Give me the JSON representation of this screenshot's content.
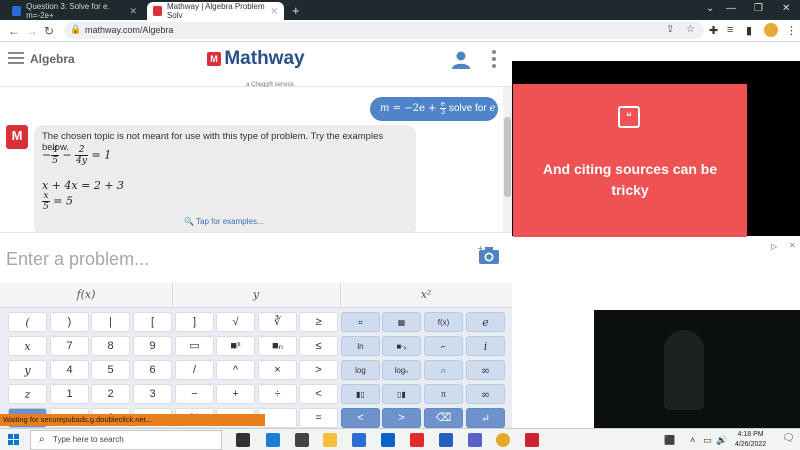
{
  "browser": {
    "tabs": [
      {
        "title": "Question 3: Solve for e. m=-2e+",
        "active": false
      },
      {
        "title": "Mathway | Algebra Problem Solv",
        "active": true
      }
    ],
    "new_tab": "+",
    "url": "mathway.com/Algebra",
    "window_controls": {
      "minimize": "—",
      "maximize": "❐",
      "close": "✕",
      "tabsearch": "⌄"
    }
  },
  "mathway": {
    "app_title": "Algebra",
    "logo_text": "Mathway",
    "logo_mark": "M",
    "logo_sub": "a Chegg® service",
    "user_query": {
      "lhs": "m",
      "expr": " = −2e + ",
      "frac_num": "e",
      "frac_den": "3",
      "suffix": " solve for ",
      "var": "e"
    },
    "bot_avatar": "M",
    "bot_message": "The chosen topic is not meant for use with this type of problem. Try the examples below.",
    "examples": {
      "ex1": {
        "prefix": "−",
        "f1_num": "4",
        "f1_den": "5",
        "mid": " − ",
        "f2_num": "2",
        "f2_den": "4y",
        "suffix": " = 1"
      },
      "ex2": "x + 4x = 2 + 3",
      "ex3": {
        "f_num": "x",
        "f_den": "5",
        "suffix": " = 5"
      }
    },
    "tap_examples": "🔍 Tap for examples...",
    "input_placeholder": "Enter a problem..."
  },
  "keypad": {
    "tabs": [
      "f(x)",
      "y",
      "x²"
    ],
    "rows": [
      [
        "(",
        ")",
        "|",
        "[",
        "]",
        "√",
        "∛",
        "≥",
        "⌗",
        "▦",
        "f(x)",
        "e"
      ],
      [
        "x",
        "7",
        "8",
        "9",
        "▭",
        "■ˣ",
        "■ₙ",
        "≤",
        "ln",
        "■·ₓ",
        "⌐",
        "i"
      ],
      [
        "y",
        "4",
        "5",
        "6",
        "/",
        "^",
        "×",
        ">",
        "log",
        "logₙ",
        "∩",
        "∞"
      ],
      [
        "z",
        "1",
        "2",
        "3",
        "−",
        "+",
        "÷",
        "<",
        "▮▯",
        "▯▮",
        "π",
        "∞"
      ],
      [
        "abc",
        "",
        "0",
        "",
        "%",
        "",
        "",
        "=",
        "<",
        ">",
        "⌫",
        "↵"
      ]
    ]
  },
  "ad": {
    "quote_mark": "“",
    "text": "And citing sources can be tricky",
    "adchoices": "▷",
    "close": "✕"
  },
  "status_bar": "Waiting for securepubads.g.doubleclick.net...",
  "taskbar": {
    "search_placeholder": "Type here to search",
    "time": "4:18 PM",
    "date": "4/26/2022"
  }
}
